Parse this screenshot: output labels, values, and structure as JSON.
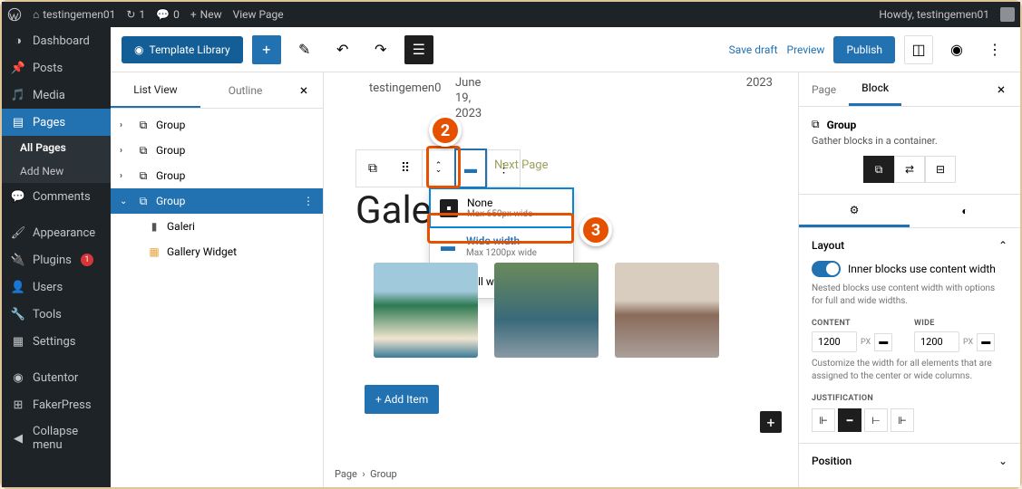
{
  "adminbar": {
    "site": "testingemen01",
    "updates": "1",
    "comments": "0",
    "new": "New",
    "viewpage": "View Page",
    "howdy": "Howdy, testingemen01"
  },
  "menu": {
    "dashboard": "Dashboard",
    "posts": "Posts",
    "media": "Media",
    "pages": "Pages",
    "allpages": "All Pages",
    "addnew": "Add New",
    "comments": "Comments",
    "appearance": "Appearance",
    "plugins": "Plugins",
    "plugins_count": "1",
    "users": "Users",
    "tools": "Tools",
    "settings": "Settings",
    "gutentor": "Gutentor",
    "fakerpress": "FakerPress",
    "collapse": "Collapse menu"
  },
  "topbar": {
    "template": "Template Library",
    "savedraft": "Save draft",
    "preview": "Preview",
    "publish": "Publish"
  },
  "listpanel": {
    "listview": "List View",
    "outline": "Outline",
    "groups": [
      "Group",
      "Group",
      "Group",
      "Group"
    ],
    "galeri": "Galeri",
    "gallery_widget": "Gallery Widget"
  },
  "canvas": {
    "date_right": "2023",
    "author": "testingemen0",
    "meta": "June\n19,\n2023",
    "nextpage": "Next Page",
    "heading": "Galer",
    "additem": "Add Item",
    "crumb_page": "Page",
    "crumb_group": "Group"
  },
  "align_popup": {
    "none": "None",
    "none_sub": "Max 650px wide",
    "wide": "Wide width",
    "wide_sub": "Max 1200px wide",
    "full": "Full width"
  },
  "sidebar": {
    "page": "Page",
    "block": "Block",
    "group": "Group",
    "group_desc": "Gather blocks in a container.",
    "layout": "Layout",
    "toggle_label": "Inner blocks use content width",
    "note": "Nested blocks use content width with options for full and wide widths.",
    "content": "CONTENT",
    "wide": "WIDE",
    "content_val": "1200",
    "wide_val": "1200",
    "unit": "PX",
    "note2": "Customize the width for all elements that are assigned to the center or wide columns.",
    "justification": "JUSTIFICATION",
    "position": "Position"
  }
}
